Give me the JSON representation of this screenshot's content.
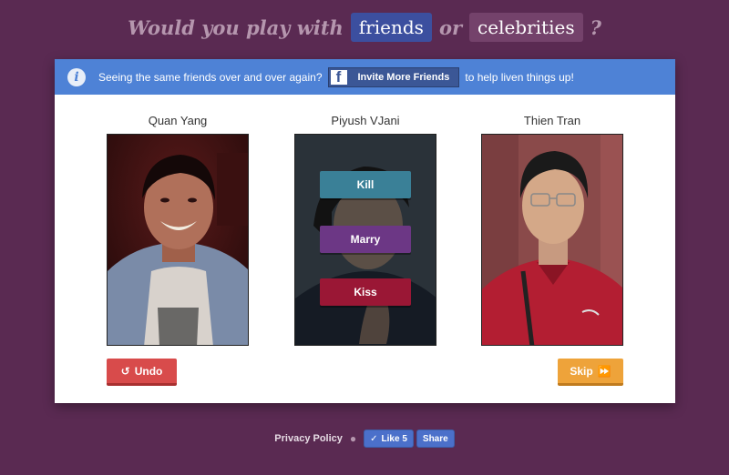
{
  "header": {
    "prefix": "Would you play with",
    "friends": "friends",
    "or": "or",
    "celebrities": "celebrities",
    "suffix": "?"
  },
  "banner": {
    "text_before": "Seeing the same friends over and over again?",
    "invite_label": "Invite More Friends",
    "text_after": "to help liven things up!"
  },
  "people": [
    {
      "name": "Quan Yang"
    },
    {
      "name": "Piyush VJani"
    },
    {
      "name": "Thien Tran"
    }
  ],
  "actions": {
    "kill": "Kill",
    "marry": "Marry",
    "kiss": "Kiss"
  },
  "controls": {
    "undo": "Undo",
    "skip": "Skip"
  },
  "footer": {
    "privacy": "Privacy Policy",
    "like": "Like 5",
    "share": "Share"
  },
  "colors": {
    "background": "#5a2a52",
    "banner": "#4e82d6",
    "kill": "#3a8097",
    "marry": "#6c3785",
    "kiss": "#9a1735",
    "undo": "#d84b4b",
    "skip": "#eea33a"
  }
}
